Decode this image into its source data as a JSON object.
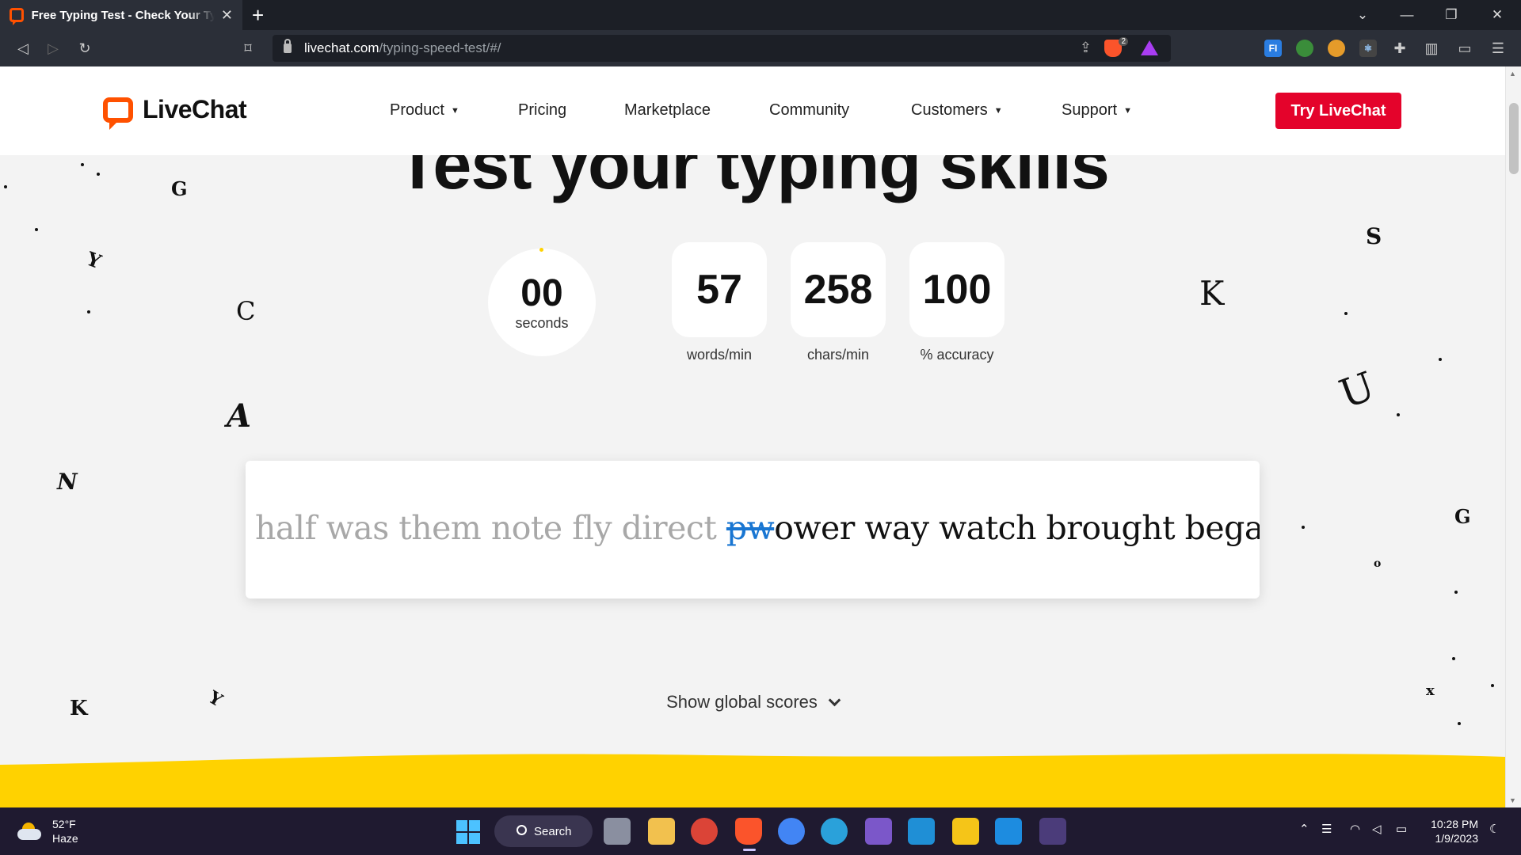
{
  "browser": {
    "tab_title": "Free Typing Test - Check Your Typing Speed",
    "url_host": "livechat.com",
    "url_path": "/typing-speed-test/#/",
    "brave_badge": "2"
  },
  "site": {
    "logo_text": "LiveChat",
    "nav": [
      {
        "label": "Product",
        "has_caret": true
      },
      {
        "label": "Pricing",
        "has_caret": false
      },
      {
        "label": "Marketplace",
        "has_caret": false
      },
      {
        "label": "Community",
        "has_caret": false
      },
      {
        "label": "Customers",
        "has_caret": true
      },
      {
        "label": "Support",
        "has_caret": true
      }
    ],
    "cta": "Try LiveChat",
    "caret_glyph": "▼"
  },
  "hero": {
    "title": "Test your typing skills"
  },
  "stats": {
    "timer_value": "00",
    "timer_label": "seconds",
    "wpm_value": "57",
    "wpm_label": "words/min",
    "cpm_value": "258",
    "cpm_label": "chars/min",
    "accuracy_value": "100",
    "accuracy_label": "% accuracy"
  },
  "typing": {
    "typed": "half was them note fly direct ",
    "wrong": "pw",
    "remaining": "ower way watch brought began c"
  },
  "global_scores": "Show global scores",
  "colors": {
    "brand_orange": "#ff5100",
    "cta_red": "#e4032b",
    "wave_yellow": "#ffd200",
    "error_blue": "#1976d2"
  },
  "taskbar": {
    "temperature": "52°F",
    "condition": "Haze",
    "search_label": "Search",
    "time": "10:28 PM",
    "date": "1/9/2023"
  },
  "icons": {
    "back": "back-arrow-icon",
    "forward": "forward-arrow-icon",
    "reload": "reload-icon",
    "bookmark": "bookmark-icon",
    "lock": "lock-icon",
    "share": "share-icon",
    "brave": "brave-shield-icon",
    "rewards": "brave-rewards-icon",
    "extensions": "puzzle-icon",
    "sidebar": "sidebar-icon",
    "wallet": "wallet-icon",
    "menu": "hamburger-menu-icon"
  }
}
